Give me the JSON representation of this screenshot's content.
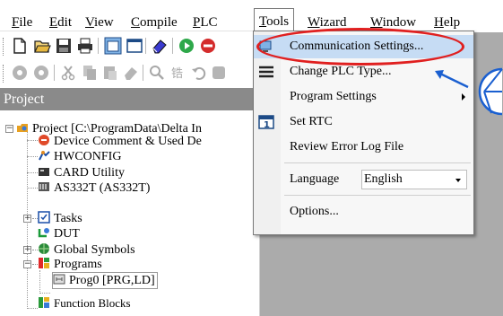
{
  "menubar": {
    "items": [
      {
        "label": "File",
        "underline": "F"
      },
      {
        "label": "Edit",
        "underline": "E"
      },
      {
        "label": "View",
        "underline": "V"
      },
      {
        "label": "Compile",
        "underline": "C"
      },
      {
        "label": "PLC",
        "underline": "P"
      },
      {
        "label": "Tools",
        "underline": "T"
      },
      {
        "label": "Wizard",
        "underline": "W"
      },
      {
        "label": "Window",
        "underline": "W"
      },
      {
        "label": "Help",
        "underline": "H"
      }
    ]
  },
  "project": {
    "header": "Project",
    "tree": [
      {
        "label": "Project [C:\\ProgramData\\Delta In",
        "icon": "project-icon"
      },
      {
        "label": "Device Comment & Used De",
        "icon": "device-comment-icon"
      },
      {
        "label": "HWCONFIG",
        "icon": "hwconfig-icon"
      },
      {
        "label": "CARD Utility",
        "icon": "card-icon"
      },
      {
        "label": "AS332T  (AS332T)",
        "icon": "plc-icon"
      },
      {
        "label": "Tasks",
        "icon": "tasks-icon"
      },
      {
        "label": "DUT",
        "icon": "dut-icon"
      },
      {
        "label": "Global Symbols",
        "icon": "global-symbols-icon"
      },
      {
        "label": "Programs",
        "icon": "programs-icon"
      },
      {
        "label": "Prog0 [PRG,LD]",
        "icon": "prog-icon"
      },
      {
        "label": "Function Blocks",
        "icon": "function-blocks-icon"
      }
    ]
  },
  "tools_menu": {
    "items": [
      {
        "label": "Communication Settings...",
        "icon": "communication-icon",
        "highlighted": true
      },
      {
        "label": "Change PLC Type...",
        "icon": "change-plc-icon"
      },
      {
        "label": "Program Settings",
        "submenu": true
      },
      {
        "label": "Set RTC",
        "icon": "calendar-icon"
      },
      {
        "label": "Review Error Log File"
      },
      {
        "label": "Language",
        "value": "English"
      },
      {
        "label": "Options..."
      }
    ]
  },
  "annotation": {
    "ellipse_color": "#e02020",
    "callout_color": "#1a5fd0"
  }
}
